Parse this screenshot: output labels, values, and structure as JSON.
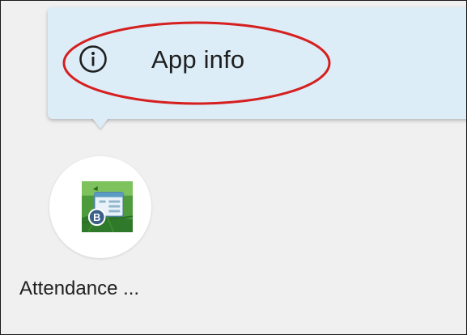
{
  "popup_menu": {
    "items": [
      {
        "label": "App info",
        "icon": "info-icon"
      }
    ]
  },
  "annotation": {
    "ellipse_color": "#d61f1f"
  },
  "app": {
    "label": "Attendance ...",
    "icon": "attendance-app-icon"
  },
  "colors": {
    "background": "#f0f0f0",
    "popup": "#dcedf8",
    "text": "#1f1f1f"
  }
}
